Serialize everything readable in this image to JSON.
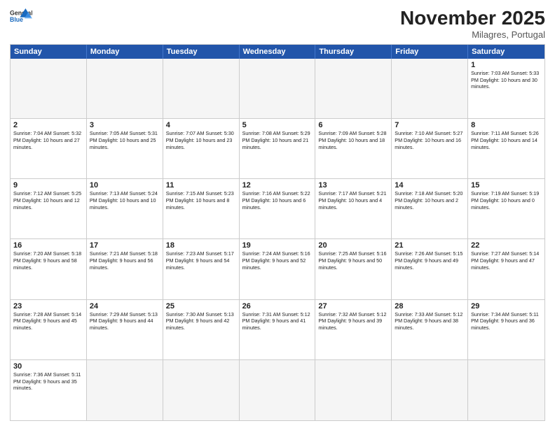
{
  "header": {
    "logo_general": "General",
    "logo_blue": "Blue",
    "month_title": "November 2025",
    "subtitle": "Milagres, Portugal"
  },
  "day_headers": [
    "Sunday",
    "Monday",
    "Tuesday",
    "Wednesday",
    "Thursday",
    "Friday",
    "Saturday"
  ],
  "cells": [
    {
      "day": "",
      "empty": true,
      "info": ""
    },
    {
      "day": "",
      "empty": true,
      "info": ""
    },
    {
      "day": "",
      "empty": true,
      "info": ""
    },
    {
      "day": "",
      "empty": true,
      "info": ""
    },
    {
      "day": "",
      "empty": true,
      "info": ""
    },
    {
      "day": "",
      "empty": true,
      "info": ""
    },
    {
      "day": "1",
      "empty": false,
      "info": "Sunrise: 7:03 AM\nSunset: 5:33 PM\nDaylight: 10 hours\nand 30 minutes."
    },
    {
      "day": "2",
      "empty": false,
      "info": "Sunrise: 7:04 AM\nSunset: 5:32 PM\nDaylight: 10 hours\nand 27 minutes."
    },
    {
      "day": "3",
      "empty": false,
      "info": "Sunrise: 7:05 AM\nSunset: 5:31 PM\nDaylight: 10 hours\nand 25 minutes."
    },
    {
      "day": "4",
      "empty": false,
      "info": "Sunrise: 7:07 AM\nSunset: 5:30 PM\nDaylight: 10 hours\nand 23 minutes."
    },
    {
      "day": "5",
      "empty": false,
      "info": "Sunrise: 7:08 AM\nSunset: 5:29 PM\nDaylight: 10 hours\nand 21 minutes."
    },
    {
      "day": "6",
      "empty": false,
      "info": "Sunrise: 7:09 AM\nSunset: 5:28 PM\nDaylight: 10 hours\nand 18 minutes."
    },
    {
      "day": "7",
      "empty": false,
      "info": "Sunrise: 7:10 AM\nSunset: 5:27 PM\nDaylight: 10 hours\nand 16 minutes."
    },
    {
      "day": "8",
      "empty": false,
      "info": "Sunrise: 7:11 AM\nSunset: 5:26 PM\nDaylight: 10 hours\nand 14 minutes."
    },
    {
      "day": "9",
      "empty": false,
      "info": "Sunrise: 7:12 AM\nSunset: 5:25 PM\nDaylight: 10 hours\nand 12 minutes."
    },
    {
      "day": "10",
      "empty": false,
      "info": "Sunrise: 7:13 AM\nSunset: 5:24 PM\nDaylight: 10 hours\nand 10 minutes."
    },
    {
      "day": "11",
      "empty": false,
      "info": "Sunrise: 7:15 AM\nSunset: 5:23 PM\nDaylight: 10 hours\nand 8 minutes."
    },
    {
      "day": "12",
      "empty": false,
      "info": "Sunrise: 7:16 AM\nSunset: 5:22 PM\nDaylight: 10 hours\nand 6 minutes."
    },
    {
      "day": "13",
      "empty": false,
      "info": "Sunrise: 7:17 AM\nSunset: 5:21 PM\nDaylight: 10 hours\nand 4 minutes."
    },
    {
      "day": "14",
      "empty": false,
      "info": "Sunrise: 7:18 AM\nSunset: 5:20 PM\nDaylight: 10 hours\nand 2 minutes."
    },
    {
      "day": "15",
      "empty": false,
      "info": "Sunrise: 7:19 AM\nSunset: 5:19 PM\nDaylight: 10 hours\nand 0 minutes."
    },
    {
      "day": "16",
      "empty": false,
      "info": "Sunrise: 7:20 AM\nSunset: 5:18 PM\nDaylight: 9 hours\nand 58 minutes."
    },
    {
      "day": "17",
      "empty": false,
      "info": "Sunrise: 7:21 AM\nSunset: 5:18 PM\nDaylight: 9 hours\nand 56 minutes."
    },
    {
      "day": "18",
      "empty": false,
      "info": "Sunrise: 7:23 AM\nSunset: 5:17 PM\nDaylight: 9 hours\nand 54 minutes."
    },
    {
      "day": "19",
      "empty": false,
      "info": "Sunrise: 7:24 AM\nSunset: 5:16 PM\nDaylight: 9 hours\nand 52 minutes."
    },
    {
      "day": "20",
      "empty": false,
      "info": "Sunrise: 7:25 AM\nSunset: 5:16 PM\nDaylight: 9 hours\nand 50 minutes."
    },
    {
      "day": "21",
      "empty": false,
      "info": "Sunrise: 7:26 AM\nSunset: 5:15 PM\nDaylight: 9 hours\nand 49 minutes."
    },
    {
      "day": "22",
      "empty": false,
      "info": "Sunrise: 7:27 AM\nSunset: 5:14 PM\nDaylight: 9 hours\nand 47 minutes."
    },
    {
      "day": "23",
      "empty": false,
      "info": "Sunrise: 7:28 AM\nSunset: 5:14 PM\nDaylight: 9 hours\nand 45 minutes."
    },
    {
      "day": "24",
      "empty": false,
      "info": "Sunrise: 7:29 AM\nSunset: 5:13 PM\nDaylight: 9 hours\nand 44 minutes."
    },
    {
      "day": "25",
      "empty": false,
      "info": "Sunrise: 7:30 AM\nSunset: 5:13 PM\nDaylight: 9 hours\nand 42 minutes."
    },
    {
      "day": "26",
      "empty": false,
      "info": "Sunrise: 7:31 AM\nSunset: 5:12 PM\nDaylight: 9 hours\nand 41 minutes."
    },
    {
      "day": "27",
      "empty": false,
      "info": "Sunrise: 7:32 AM\nSunset: 5:12 PM\nDaylight: 9 hours\nand 39 minutes."
    },
    {
      "day": "28",
      "empty": false,
      "info": "Sunrise: 7:33 AM\nSunset: 5:12 PM\nDaylight: 9 hours\nand 38 minutes."
    },
    {
      "day": "29",
      "empty": false,
      "info": "Sunrise: 7:34 AM\nSunset: 5:11 PM\nDaylight: 9 hours\nand 36 minutes."
    },
    {
      "day": "30",
      "empty": false,
      "info": "Sunrise: 7:36 AM\nSunset: 5:11 PM\nDaylight: 9 hours\nand 35 minutes."
    },
    {
      "day": "",
      "empty": true,
      "info": ""
    },
    {
      "day": "",
      "empty": true,
      "info": ""
    },
    {
      "day": "",
      "empty": true,
      "info": ""
    },
    {
      "day": "",
      "empty": true,
      "info": ""
    },
    {
      "day": "",
      "empty": true,
      "info": ""
    },
    {
      "day": "",
      "empty": true,
      "info": ""
    }
  ]
}
